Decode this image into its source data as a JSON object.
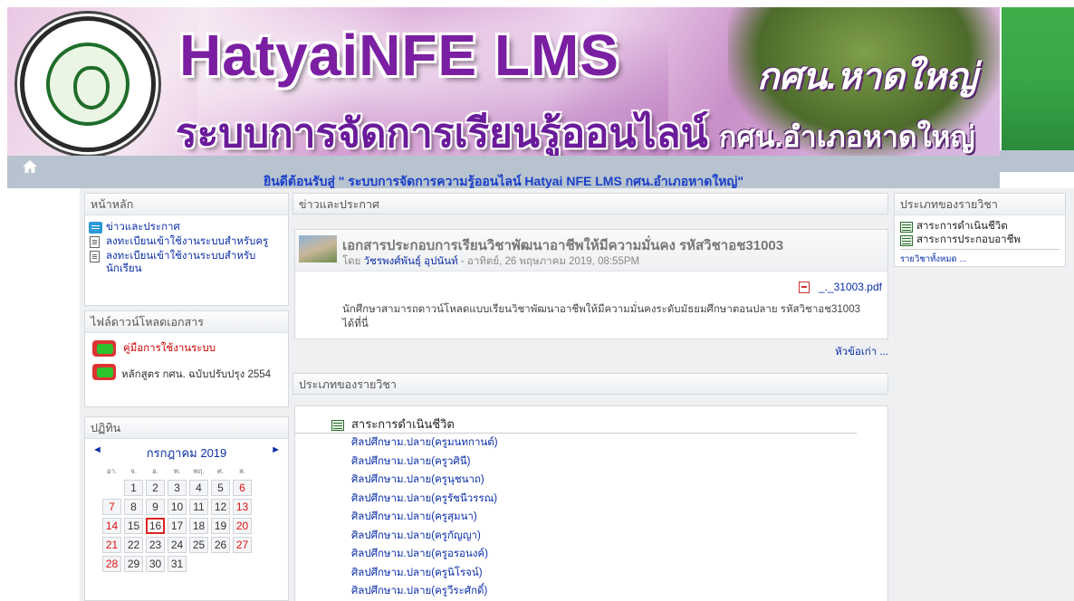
{
  "header": {
    "title_main": "HatyaiNFE LMS",
    "title_side": "กศน.หาดใหญ่",
    "title_thai": "ระบบการจัดการเรียนรู้ออนไลน์",
    "title_thai_small": "กศน.อำเภอหาดใหญ่",
    "welcome": "ยินดีต้อนรับสู่ \" ระบบการจัดการความรู้ออนไลน์ Hatyai NFE LMS กศน.อำเภอหาดใหญ่\""
  },
  "left": {
    "home_block": {
      "title": "หน้าหลัก",
      "items": [
        {
          "label": "ข่าวและประกาศ",
          "icon": "news-icon"
        },
        {
          "label": "ลงทะเบียนเข้าใช้งานระบบสำหรับครู",
          "icon": "page-icon"
        },
        {
          "label": "ลงทะเบียนเข้าใช้งานระบบสำหรับนักเรียน",
          "icon": "page-icon"
        }
      ]
    },
    "downloads_block": {
      "title": "ไฟล์ดาวน์โหลดเอกสาร",
      "items": [
        {
          "label": "คู่มือการใช้งานระบบ",
          "color": "#cc0000"
        },
        {
          "label": "หลักสูตร กศน. ฉบับปรับปรุง 2554",
          "color": "#333333"
        }
      ]
    },
    "calendar": {
      "title": "ปฏิทิน",
      "month": "กรกฎาคม 2019",
      "prev": "◄",
      "next": "►",
      "weekdays": [
        "อา.",
        "จ.",
        "อ.",
        "พ.",
        "พฤ.",
        "ศ.",
        "ส."
      ],
      "weeks": [
        [
          "",
          "1",
          "2",
          "3",
          "4",
          "5",
          "6"
        ],
        [
          "7",
          "8",
          "9",
          "10",
          "11",
          "12",
          "13"
        ],
        [
          "14",
          "15",
          "16",
          "17",
          "18",
          "19",
          "20"
        ],
        [
          "21",
          "22",
          "23",
          "24",
          "25",
          "26",
          "27"
        ],
        [
          "28",
          "29",
          "30",
          "31",
          "",
          "",
          ""
        ]
      ],
      "today": "16"
    }
  },
  "main": {
    "news_block": {
      "title": "ข่าวและประกาศ",
      "post": {
        "subject": "เอกสารประกอบการเรียนวิชาพัฒนาอาชีพให้มีความมั่นคง รหัสวิชาอช31003",
        "by_prefix": "โดย",
        "author": "วัชรพงศ์พันธุ์ อุปนันท์",
        "date": "- อาทิตย์, 26 พฤษภาคม 2019, 08:55PM",
        "attachment": "_._31003.pdf",
        "body": "นักศึกษาสามารถดาวน์โหลดแบบเรียนวิชาพัฒนาอาชีพให้มีความมั่นคงระดับมัธยมศึกษาตอนปลาย รหัสวิชาอช31003 ได้ที่นี่"
      },
      "older": "หัวข้อเก่า ..."
    },
    "categories_block": {
      "title": "ประเภทของรายวิชา",
      "category": "สาระการดำเนินชีวิต",
      "courses": [
        "ศิลปศึกษาม.ปลาย(ครูมนทกานต์)",
        "ศิลปศึกษาม.ปลาย(ครูวศินี)",
        "ศิลปศึกษาม.ปลาย(ครูนุชนาถ)",
        "ศิลปศึกษาม.ปลาย(ครูรัชนีวรรณ)",
        "ศิลปศึกษาม.ปลาย(ครูสุมนา)",
        "ศิลปศึกษาม.ปลาย(ครูกัญญา)",
        "ศิลปศึกษาม.ปลาย(ครูอรอนงค์)",
        "ศิลปศึกษาม.ปลาย(ครูนิโรจน์)",
        "ศิลปศึกษาม.ปลาย(ครูวีระศักดิ์)"
      ]
    }
  },
  "right": {
    "categories_block": {
      "title": "ประเภทของรายวิชา",
      "items": [
        "สาระการดำเนินชีวิต",
        "สาระการประกอบอาชีพ"
      ],
      "all_link": "รายวิชาทั้งหมด ..."
    }
  }
}
